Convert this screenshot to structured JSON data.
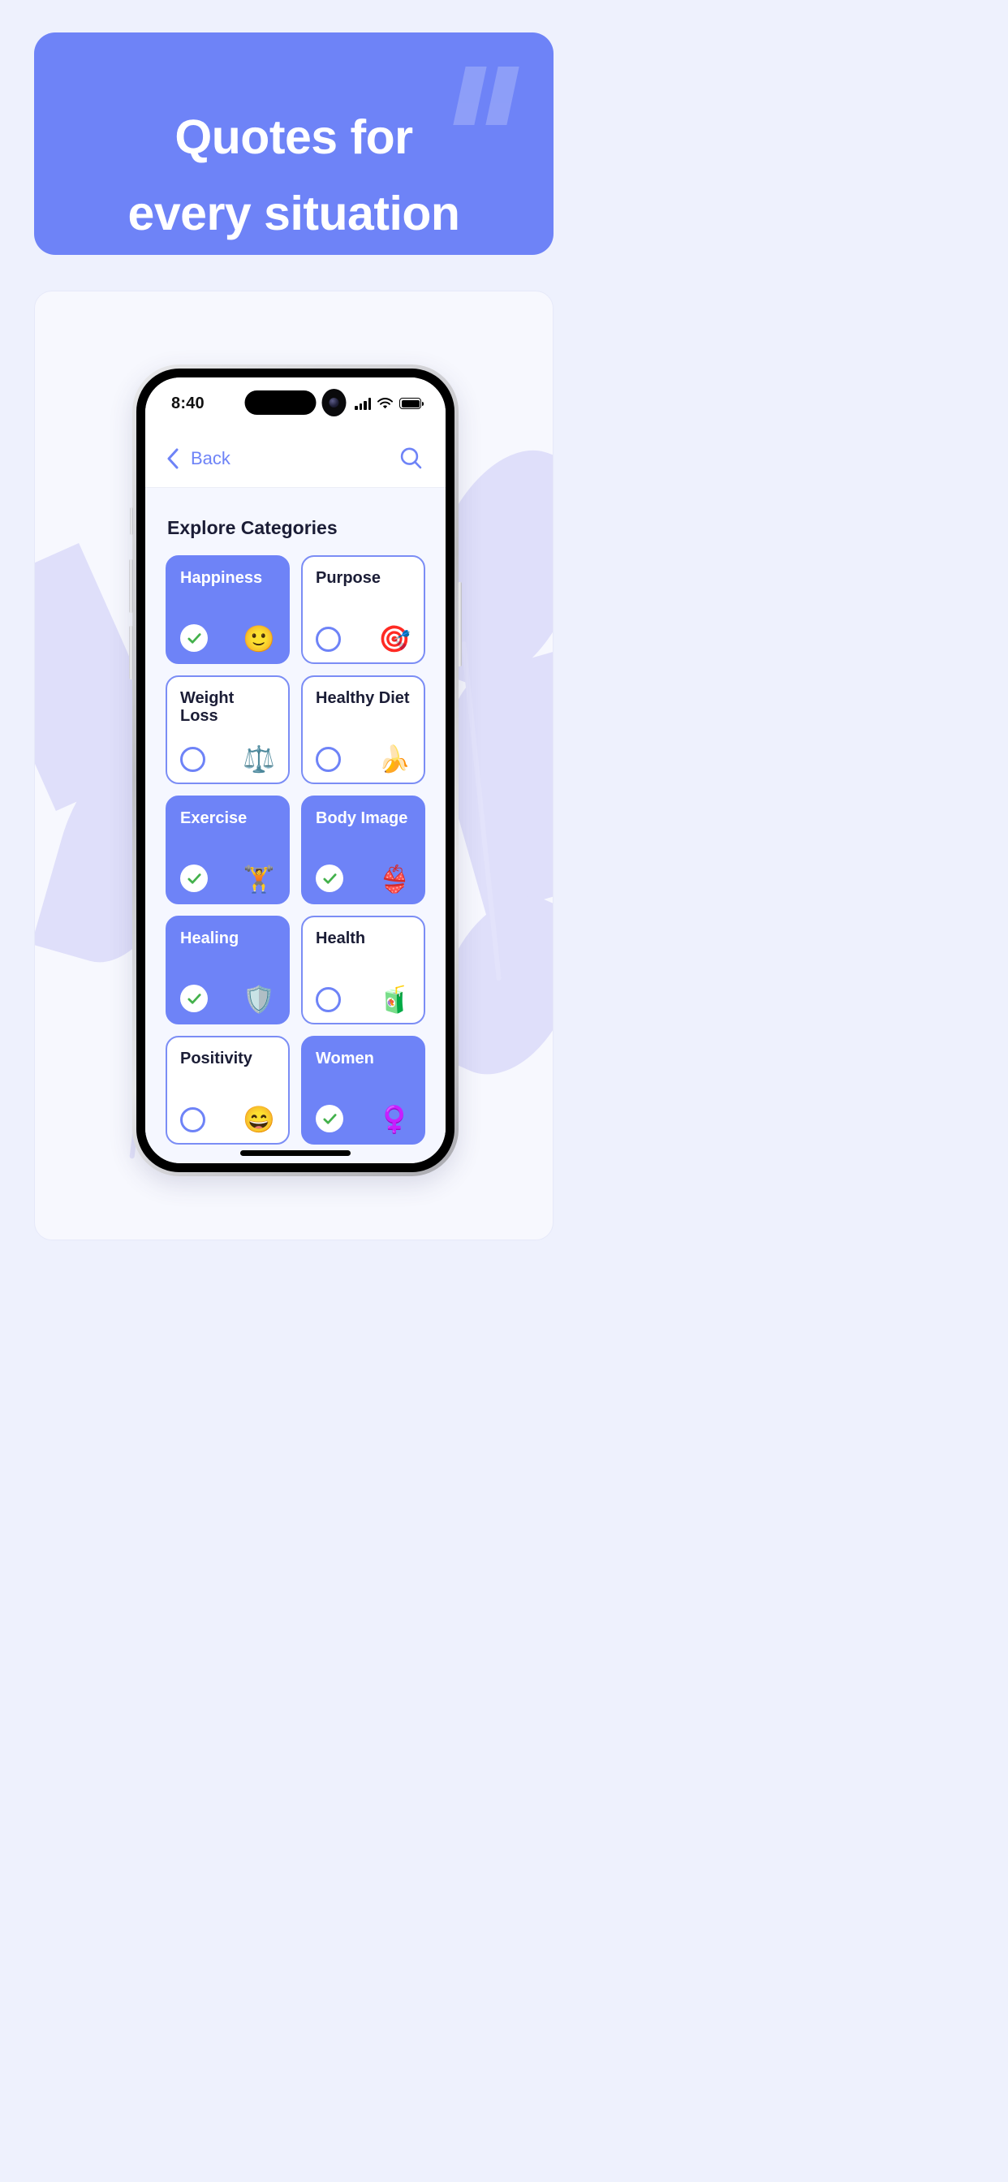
{
  "banner": {
    "title_line1": "Quotes for",
    "title_line2": "every situation",
    "background_color": "#6e83f7",
    "quote_mark_icon": "double-quote-icon"
  },
  "phone": {
    "status_bar": {
      "time": "8:40",
      "signal_icon": "cellular-signal-icon",
      "wifi_icon": "wifi-icon",
      "battery_icon": "battery-full-icon"
    },
    "nav_bar": {
      "back_label": "Back",
      "back_icon": "chevron-left-icon",
      "search_icon": "search-icon"
    },
    "content": {
      "section_title": "Explore Categories",
      "categories": [
        {
          "label": "Happiness",
          "emoji": "🙂",
          "emoji_name": "slightly-smiling-face-emoji",
          "selected": true
        },
        {
          "label": "Purpose",
          "emoji": "🎯",
          "emoji_name": "dart-target-emoji",
          "selected": false
        },
        {
          "label": "Weight Loss",
          "emoji": "⚖️",
          "emoji_name": "bathroom-scale-emoji",
          "selected": false
        },
        {
          "label": "Healthy Diet",
          "emoji": "🍌",
          "emoji_name": "fruit-basket-emoji",
          "selected": false
        },
        {
          "label": "Exercise",
          "emoji": "🏋️",
          "emoji_name": "kettlebell-emoji",
          "selected": true
        },
        {
          "label": "Body Image",
          "emoji": "👙",
          "emoji_name": "bikini-figure-emoji",
          "selected": true
        },
        {
          "label": "Healing",
          "emoji": "🛡️",
          "emoji_name": "medical-shield-emoji",
          "selected": true
        },
        {
          "label": "Health",
          "emoji": "🧃",
          "emoji_name": "juice-glass-emoji",
          "selected": false
        },
        {
          "label": "Positivity",
          "emoji": "😄",
          "emoji_name": "grinning-face-emoji",
          "selected": false
        },
        {
          "label": "Women",
          "emoji": "♀️",
          "emoji_name": "female-sign-emoji",
          "selected": true
        }
      ]
    }
  },
  "colors": {
    "page_background": "#eef1fd",
    "accent": "#6e83f7",
    "panel_background": "#f7f8fe",
    "leaf": "#dfdffa",
    "check_green": "#43b14b",
    "text_dark": "#1b1d36"
  }
}
